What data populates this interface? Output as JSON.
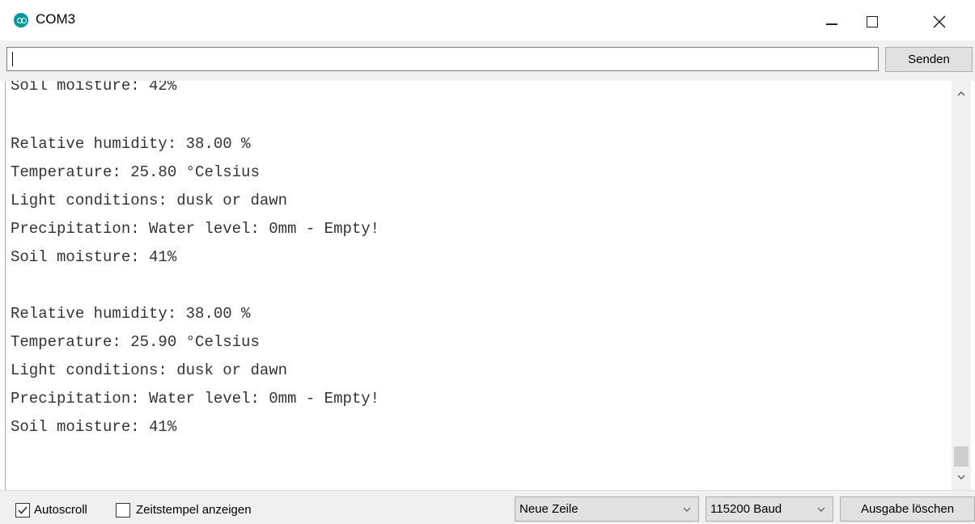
{
  "window": {
    "title": "COM3",
    "icon": "arduino-icon",
    "controls": [
      "minimize-icon",
      "maximize-icon",
      "close-icon"
    ]
  },
  "send_bar": {
    "input_value": "",
    "send_label": "Senden"
  },
  "output": {
    "lines": [
      "Soil moisture: 42%",
      "",
      "Relative humidity: 38.00 %",
      "Temperature: 25.80 °Celsius",
      "Light conditions: dusk or dawn",
      "Precipitation: Water level: 0mm - Empty!",
      "Soil moisture: 41%",
      "",
      "Relative humidity: 38.00 %",
      "Temperature: 25.90 °Celsius",
      "Light conditions: dusk or dawn",
      "Precipitation: Water level: 0mm - Empty!",
      "Soil moisture: 41%"
    ]
  },
  "bottom_bar": {
    "autoscroll_label": "Autoscroll",
    "autoscroll_checked": true,
    "timestamp_label": "Zeitstempel anzeigen",
    "timestamp_checked": false,
    "line_ending_selected": "Neue Zeile",
    "baud_selected": "115200 Baud",
    "clear_label": "Ausgabe löschen"
  },
  "colors": {
    "arduino_teal": "#00979c",
    "chrome_bg": "#f0f0f0",
    "button_bg": "#e1e1e1",
    "text_output": "#333333"
  }
}
